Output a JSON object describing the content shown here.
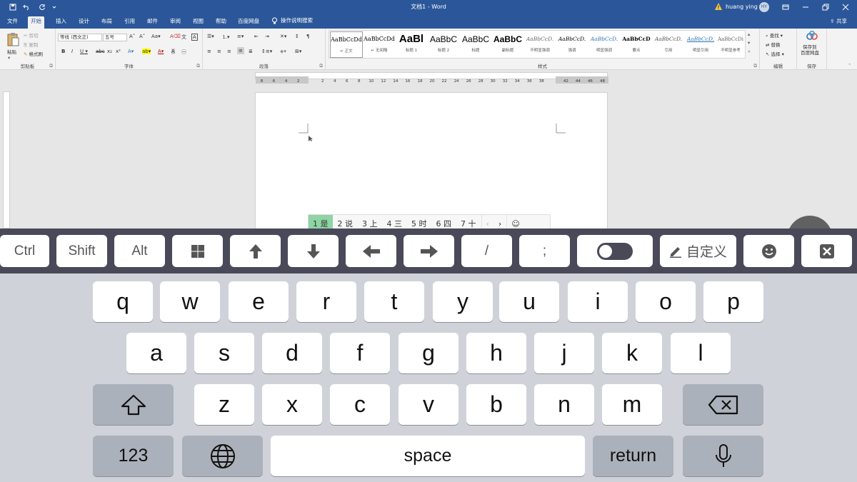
{
  "window": {
    "title": "文档1 - Word",
    "user_name": "huang ying",
    "avatar_initials": "HY",
    "accent": "#2b579a"
  },
  "tabs": [
    {
      "label": "文件"
    },
    {
      "label": "开始"
    },
    {
      "label": "插入"
    },
    {
      "label": "设计"
    },
    {
      "label": "布局"
    },
    {
      "label": "引用"
    },
    {
      "label": "邮件"
    },
    {
      "label": "审阅"
    },
    {
      "label": "视图"
    },
    {
      "label": "帮助"
    },
    {
      "label": "百度网盘"
    }
  ],
  "tell_me": "操作说明搜索",
  "share": "共享",
  "ribbon": {
    "clipboard": {
      "paste": "粘贴",
      "cut": "剪切",
      "copy": "复制",
      "format_painter": "格式刷",
      "label": "剪贴板"
    },
    "font": {
      "name": "等线 (西文正)",
      "size": "五号",
      "label": "字体"
    },
    "paragraph": {
      "label": "段落"
    },
    "styles": {
      "label": "样式",
      "items": [
        {
          "preview": "AaBbCcDd",
          "name": "↵ 正文"
        },
        {
          "preview": "AaBbCcDd",
          "name": "↵ 无间隔"
        },
        {
          "preview": "AaBl",
          "name": "标题 1"
        },
        {
          "preview": "AaBbC",
          "name": "标题 2"
        },
        {
          "preview": "AaBbC",
          "name": "标题"
        },
        {
          "preview": "AaBbC",
          "name": "副标题"
        },
        {
          "preview": "AaBbCcD.",
          "name": "不明显强调"
        },
        {
          "preview": "AaBbCcD.",
          "name": "强调"
        },
        {
          "preview": "AaBbCcD.",
          "name": "明显强调"
        },
        {
          "preview": "AaBbCcD",
          "name": "要点"
        },
        {
          "preview": "AaBbCcD.",
          "name": "引用"
        },
        {
          "preview": "AaBbCcD.",
          "name": "明显引用"
        },
        {
          "preview": "AaBbCcDi",
          "name": "不明显参考"
        }
      ]
    },
    "editing": {
      "find": "查找",
      "replace": "替换",
      "select": "选择",
      "label": "编辑"
    },
    "save": {
      "line1": "保存到",
      "line2": "百度网盘",
      "label": "保存"
    }
  },
  "ruler": {
    "h_ticks": [
      "8",
      "6",
      "4",
      "2",
      "",
      "2",
      "4",
      "6",
      "8",
      "10",
      "12",
      "14",
      "16",
      "18",
      "20",
      "22",
      "24",
      "26",
      "28",
      "30",
      "32",
      "34",
      "36",
      "38",
      "",
      "42",
      "44",
      "46",
      "48"
    ]
  },
  "ime": {
    "candidates": [
      {
        "num": "1",
        "text": "是"
      },
      {
        "num": "2",
        "text": "说"
      },
      {
        "num": "3",
        "text": "上"
      },
      {
        "num": "4",
        "text": "三"
      },
      {
        "num": "5",
        "text": "时"
      },
      {
        "num": "6",
        "text": "四"
      },
      {
        "num": "7",
        "text": "十"
      }
    ],
    "prev": "‹",
    "next": "›",
    "highlight": "#8fd4a4"
  },
  "shortcut_bar": {
    "ctrl": "Ctrl",
    "shift": "Shift",
    "alt": "Alt",
    "slash": "/",
    "semicolon": ";",
    "custom": "自定义"
  },
  "keyboard": {
    "row1": [
      "q",
      "w",
      "e",
      "r",
      "t",
      "y",
      "u",
      "i",
      "o",
      "p"
    ],
    "row2": [
      "a",
      "s",
      "d",
      "f",
      "g",
      "h",
      "j",
      "k",
      "l"
    ],
    "row3": [
      "z",
      "x",
      "c",
      "v",
      "b",
      "n",
      "m"
    ],
    "numbers": "123",
    "space": "space",
    "return": "return"
  }
}
